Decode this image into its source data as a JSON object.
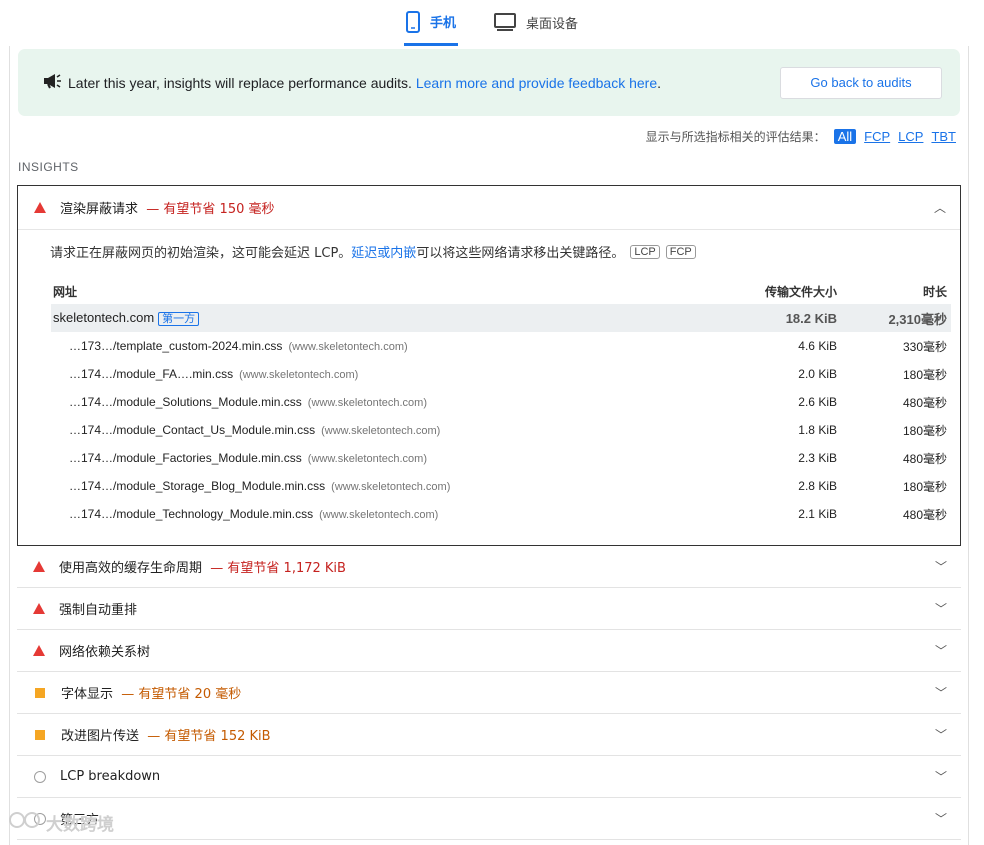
{
  "tabs": [
    {
      "label": "手机",
      "icon": "phone-icon"
    },
    {
      "label": "桌面设备",
      "icon": "desktop-icon"
    }
  ],
  "banner": {
    "icon": "megaphone-icon",
    "message": "Later this year, insights will replace performance audits.",
    "link": "Learn more and provide feedback here",
    "period": ".",
    "button": "Go back to audits"
  },
  "filter": {
    "label": "显示与所选指标相关的评估结果：",
    "chips": [
      "All",
      "FCP",
      "LCP",
      "TBT"
    ]
  },
  "section_title": "INSIGHTS",
  "open_audit": {
    "title": "渲染屏蔽请求",
    "savings": "— 有望节省 150 毫秒",
    "description": "请求正在屏蔽网页的初始渲染，这可能会延迟 LCP。",
    "desc_link": "延迟或内嵌",
    "desc_tail": "可以将这些网络请求移出关键路径。",
    "tags": [
      "LCP",
      "FCP"
    ],
    "columns": {
      "url": "网址",
      "size": "传输文件大小",
      "duration": "时长"
    },
    "group": {
      "name": "skeletontech.com",
      "badge": "第一方",
      "size": "18.2 KiB",
      "duration": "2,310毫秒"
    },
    "rows": [
      {
        "url": "…173…/template_custom-2024.min.css",
        "host": "(www.skeletontech.com)",
        "size": "4.6 KiB",
        "duration": "330毫秒"
      },
      {
        "url": "…174…/module_FA….min.css",
        "host": "(www.skeletontech.com)",
        "size": "2.0 KiB",
        "duration": "180毫秒"
      },
      {
        "url": "…174…/module_Solutions_Module.min.css",
        "host": "(www.skeletontech.com)",
        "size": "2.6 KiB",
        "duration": "480毫秒"
      },
      {
        "url": "…174…/module_Contact_Us_Module.min.css",
        "host": "(www.skeletontech.com)",
        "size": "1.8 KiB",
        "duration": "180毫秒"
      },
      {
        "url": "…174…/module_Factories_Module.min.css",
        "host": "(www.skeletontech.com)",
        "size": "2.3 KiB",
        "duration": "480毫秒"
      },
      {
        "url": "…174…/module_Storage_Blog_Module.min.css",
        "host": "(www.skeletontech.com)",
        "size": "2.8 KiB",
        "duration": "180毫秒"
      },
      {
        "url": "…174…/module_Technology_Module.min.css",
        "host": "(www.skeletontech.com)",
        "size": "2.1 KiB",
        "duration": "480毫秒"
      }
    ]
  },
  "audits": [
    {
      "title": "使用高效的缓存生命周期",
      "savings": "— 有望节省 1,172 KiB",
      "severity": "fail"
    },
    {
      "title": "强制自动重排",
      "savings": "",
      "severity": "fail"
    },
    {
      "title": "网络依赖关系树",
      "savings": "",
      "severity": "fail"
    },
    {
      "title": "字体显示",
      "savings": "— 有望节省 20 毫秒",
      "severity": "average"
    },
    {
      "title": "改进图片传送",
      "savings": "— 有望节省 152 KiB",
      "severity": "average"
    },
    {
      "title": "LCP breakdown",
      "savings": "",
      "severity": "info"
    },
    {
      "title": "第三方",
      "savings": "",
      "severity": "info"
    }
  ],
  "watermark": "大数跨境",
  "colors": {
    "accent": "#1a73e8",
    "fail": "#e53935",
    "average": "#f5a623",
    "banner_bg": "#e8f5ee"
  }
}
